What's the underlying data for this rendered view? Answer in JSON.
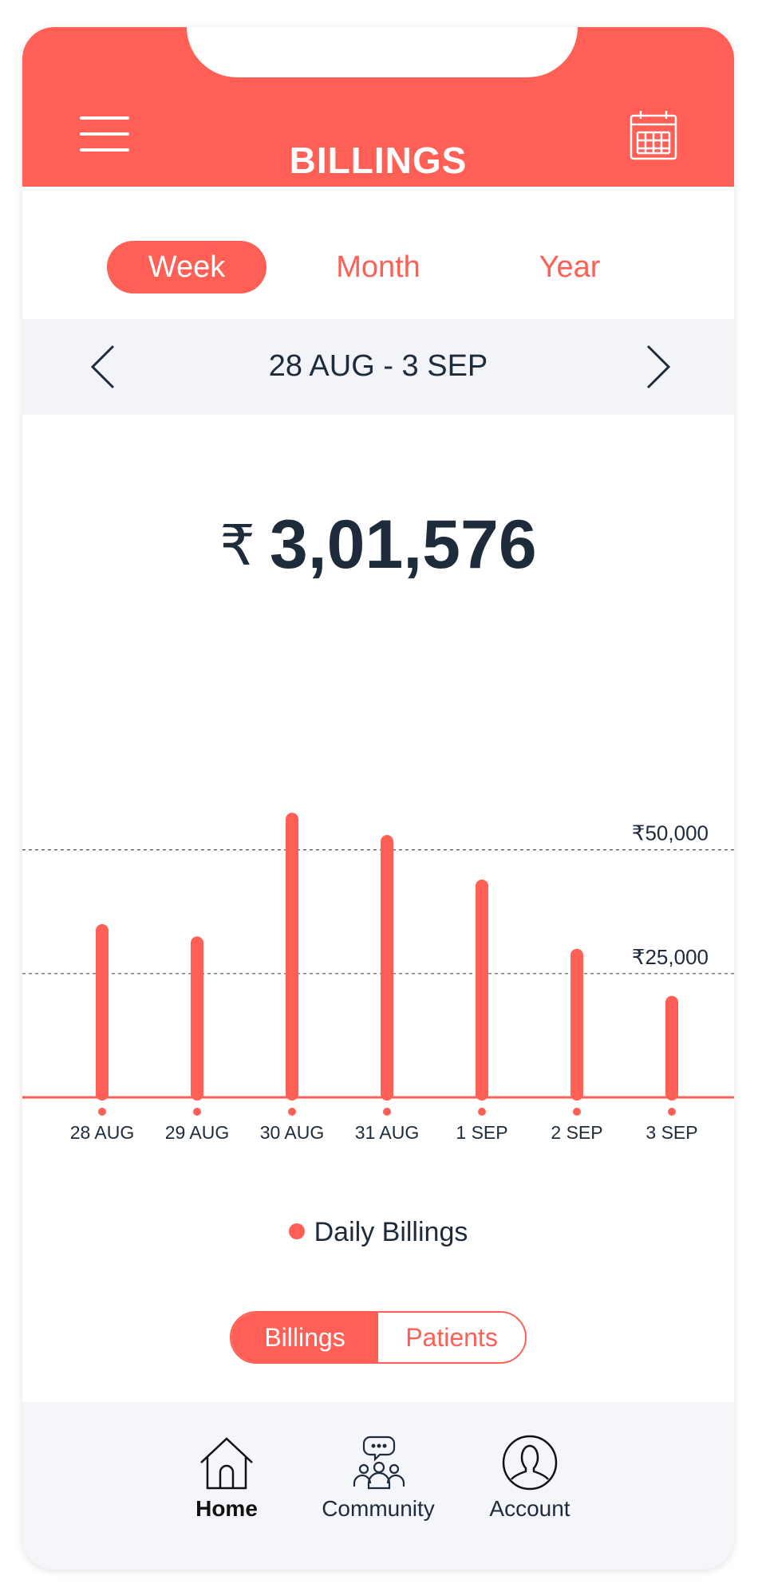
{
  "header": {
    "title": "BILLINGS"
  },
  "period_tabs": [
    {
      "label": "Week",
      "active": true
    },
    {
      "label": "Month",
      "active": false
    },
    {
      "label": "Year",
      "active": false
    }
  ],
  "date_nav": {
    "label": "28 AUG - 3 SEP"
  },
  "total": {
    "currency": "₹",
    "amount": "3,01,576"
  },
  "colors": {
    "accent": "#FF5F54",
    "text": "#1E2B3A",
    "nav_bg": "#F4F6FA",
    "date_bg": "#F2F4F7"
  },
  "chart_data": {
    "type": "bar",
    "categories": [
      "28 AUG",
      "29 AUG",
      "30 AUG",
      "31 AUG",
      "1 SEP",
      "2 SEP",
      "3 SEP"
    ],
    "series": [
      {
        "name": "Daily Billings",
        "values": [
          35000,
          32500,
          57500,
          53000,
          44000,
          30000,
          20500
        ]
      }
    ],
    "reference_lines": [
      {
        "value": 50000,
        "label": "₹50,000"
      },
      {
        "value": 25000,
        "label": "₹25,000"
      }
    ],
    "ylim": [
      0,
      58000
    ],
    "grid": "dashed reference lines",
    "legend": "bottom-center"
  },
  "legend": {
    "label": "Daily Billings"
  },
  "metric_toggle": [
    {
      "label": "Billings",
      "active": true
    },
    {
      "label": "Patients",
      "active": false
    }
  ],
  "bottom_nav": [
    {
      "label": "Home",
      "icon": "home-icon",
      "active": true
    },
    {
      "label": "Community",
      "icon": "community-icon",
      "active": false
    },
    {
      "label": "Account",
      "icon": "account-icon",
      "active": false
    }
  ]
}
